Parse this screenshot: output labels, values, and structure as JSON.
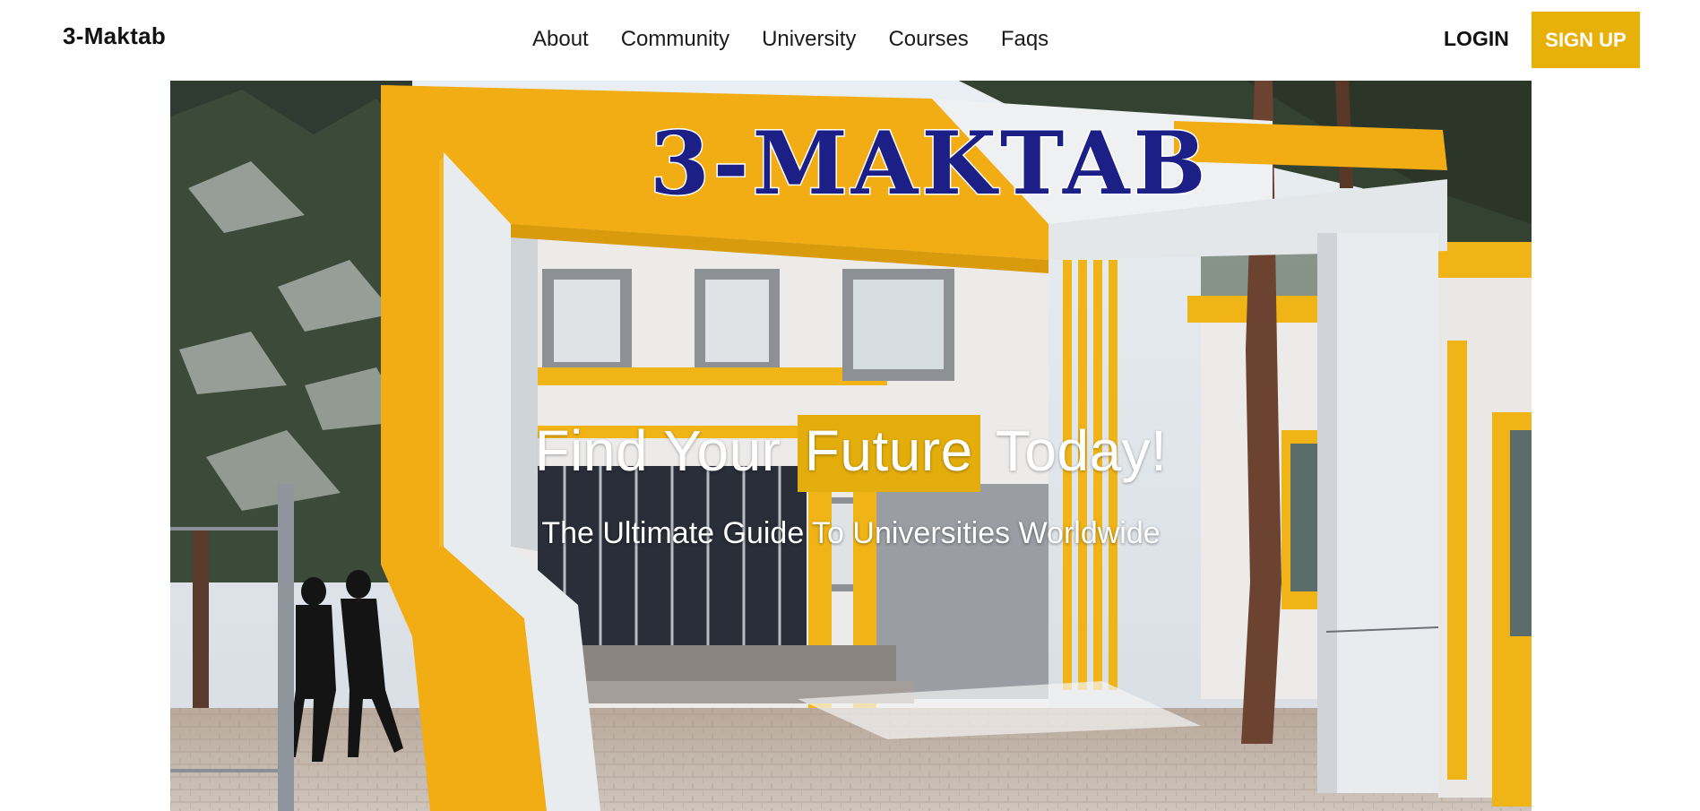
{
  "navbar": {
    "brand": "3-Maktab",
    "links": [
      "About",
      "Community",
      "University",
      "Courses",
      "Faqs"
    ],
    "login_label": "LOGIN",
    "signup_label": "SIGN UP"
  },
  "hero": {
    "sign_text": "3-MAKTAB",
    "title_before": "Find Your ",
    "title_highlight": "Future",
    "title_after": " Today!",
    "subtitle": "The Ultimate Guide To Universities Worldwide"
  },
  "colors": {
    "accent": "#e8b10a",
    "sign_blue": "#1c1f86",
    "text_dark": "#111111"
  }
}
